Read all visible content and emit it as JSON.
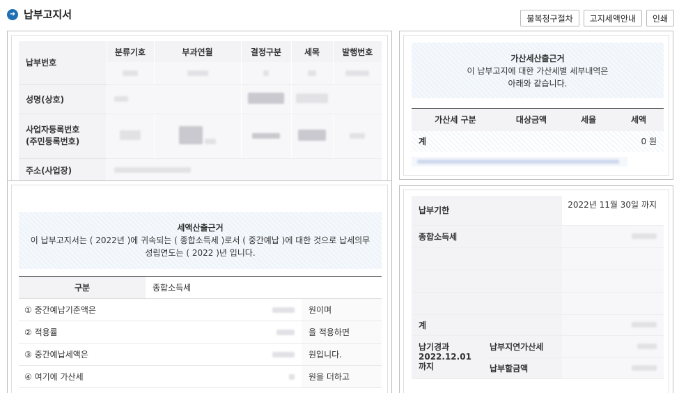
{
  "header": {
    "title": "납부고지서",
    "buttons": [
      "불복청구절차",
      "고지세액안내",
      "인쇄"
    ]
  },
  "info_table": {
    "labels": {
      "payment_no": "납부번호",
      "name": "성명(상호)",
      "business_reg_1": "사업자등록번호",
      "business_reg_2": "(주민등록번호)",
      "address": "주소(사업장)"
    },
    "columns": [
      "분류기호",
      "부과연월",
      "결정구분",
      "세목",
      "발행번호"
    ]
  },
  "surcharge": {
    "title": "가산세산출근거",
    "line1": "이 납부고지에 대한 가산세별 세부내역은",
    "line2": "아래와 같습니다.",
    "columns": [
      "가산세 구분",
      "대상금액",
      "세율",
      "세액"
    ],
    "total_label": "계",
    "total_value": "0 원"
  },
  "tax_basis": {
    "title": "세액산출근거",
    "line1": "이 납부고지서는 ( 2022년 )에 귀속되는 ( 종합소득세 )로서 ( 중간예납 )에 대한 것으로 납세의무",
    "line2": "성립연도는 ( 2022 )년 입니다.",
    "columns": [
      "구분",
      "종합소득세",
      "",
      ""
    ],
    "rows": [
      {
        "label": "① 중간예납기준액은",
        "suffix": "원이며"
      },
      {
        "label": "② 적용률",
        "suffix": "을 적용하면"
      },
      {
        "label": "③ 중간예납세액은",
        "suffix": "원입니다."
      },
      {
        "label": "④ 여기에 가산세",
        "suffix": "원을 더하고"
      }
    ]
  },
  "due": {
    "due_label": "납부기한",
    "due_value": "2022년 11월 30일 까지",
    "tax_label": "종합소득세",
    "total_label": "계",
    "overdue_label": "납기경과",
    "overdue_date": "2022.12.01",
    "overdue_until": "까지",
    "late_fee_label": "납부지연가산세",
    "payable_label": "납부할금액"
  },
  "colors": {
    "accent": "#1f6fb5",
    "notice_bg": "#eef4fa"
  }
}
